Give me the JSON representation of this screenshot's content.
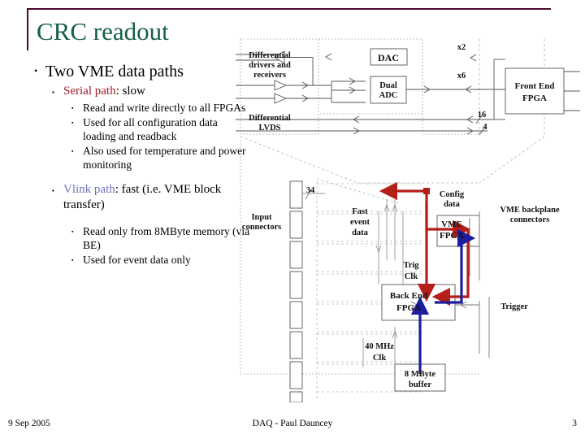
{
  "slide": {
    "title": "CRC readout",
    "title_color": "#136043",
    "rule_color": "#4a0b30"
  },
  "bullets": [
    {
      "level": 1,
      "text": "Two VME data paths"
    },
    {
      "level": 2,
      "lead": "Serial path",
      "lead_color": "#9e1b26",
      "text": ": slow"
    },
    {
      "level": 3,
      "text": "Read and write directly to all FPGAs"
    },
    {
      "level": 3,
      "text": "Used for all configuration data loading and readback"
    },
    {
      "level": 3,
      "text": "Also used for temperature and power monitoring"
    },
    {
      "level": 2,
      "lead": "Vlink path",
      "lead_color": "#6c72b8",
      "text": ": fast (i.e. VME block transfer)"
    },
    {
      "level": 3,
      "text": "Read only from 8MByte memory (via BE)"
    },
    {
      "level": 3,
      "text": "Used for event data only"
    }
  ],
  "bullet_text": {
    "b1": "Two VME data paths",
    "serial_lead": "Serial path",
    "serial_rest": ": slow",
    "serial_s1": "Read and write directly to all FPGAs",
    "serial_s2": "Used for all configuration data loading and readback",
    "serial_s3": "Also used for temperature and power monitoring",
    "vlink_lead": "Vlink path",
    "vlink_rest": ": fast (i.e. VME block transfer)",
    "vlink_s1": "Read only from 8MByte memory (via BE)",
    "vlink_s2": "Used for event data only"
  },
  "footer": {
    "date": "9 Sep 2005",
    "center": "DAQ - Paul Dauncey",
    "page": "3"
  },
  "diagram": {
    "labels": {
      "diff_drivers": [
        "Differential",
        "drivers and",
        "receivers"
      ],
      "diff_lvds": [
        "Differential",
        "LVDS"
      ],
      "input_connectors": [
        "Input",
        "connectors"
      ],
      "dac": "DAC",
      "dual_adc": [
        "Dual",
        "ADC"
      ],
      "x2": "x2",
      "x6": "x6",
      "bus16": "16",
      "bus4": "4",
      "bus34": "34",
      "front_end_fpga": [
        "Front End",
        "FPGA"
      ],
      "back_end_fpga": [
        "Back End",
        "FPGA"
      ],
      "vme_fpga": [
        "VME",
        "FPGA"
      ],
      "vme_backplane": [
        "VME backplane",
        "connectors"
      ],
      "config_data": [
        "Config",
        "data"
      ],
      "fast_event_data": [
        "Fast",
        "event",
        "data"
      ],
      "trig_clk": [
        "Trig",
        "Clk"
      ],
      "clk40": [
        "40 MHz",
        "Clk"
      ],
      "buffer8mb": [
        "8 MByte",
        "buffer"
      ],
      "trigger": "Trigger"
    },
    "colors": {
      "serial_path_arrow": "#b51f19",
      "vlink_path_arrow": "#1c1c9e",
      "line": "#555555",
      "dashed": "#9a9a9a"
    }
  }
}
